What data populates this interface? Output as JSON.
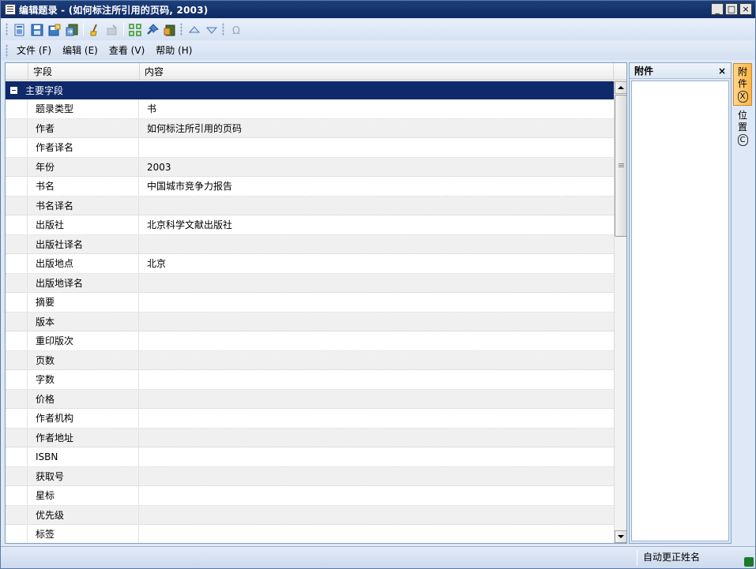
{
  "window": {
    "title": "编辑题录 - (如何标注所引用的页码, 2003)",
    "minimize": "_",
    "maximize": "□",
    "close": "×"
  },
  "toolbar": {
    "icons": [
      "new-record-icon",
      "save-icon",
      "save-as-icon",
      "export-icon",
      "clear-icon",
      "disabled-tool-icon",
      "grid-icon",
      "pin-icon",
      "attach-book-icon",
      "move-up-icon",
      "move-down-icon",
      "omega-icon"
    ]
  },
  "menu": {
    "file": "文件 (F)",
    "edit": "编辑 (E)",
    "view": "查看 (V)",
    "help": "帮助 (H)"
  },
  "grid": {
    "col_field": "字段",
    "col_value": "内容",
    "group_label": "主要字段",
    "rows": [
      {
        "field": "题录类型",
        "value": "书"
      },
      {
        "field": "作者",
        "value": "如何标注所引用的页码"
      },
      {
        "field": "作者译名",
        "value": ""
      },
      {
        "field": "年份",
        "value": "2003"
      },
      {
        "field": "书名",
        "value": "中国城市竞争力报告"
      },
      {
        "field": "书名译名",
        "value": ""
      },
      {
        "field": "出版社",
        "value": "北京科学文献出版社"
      },
      {
        "field": "出版社译名",
        "value": ""
      },
      {
        "field": "出版地点",
        "value": "北京"
      },
      {
        "field": "出版地译名",
        "value": ""
      },
      {
        "field": "摘要",
        "value": ""
      },
      {
        "field": "版本",
        "value": ""
      },
      {
        "field": "重印版次",
        "value": ""
      },
      {
        "field": "页数",
        "value": ""
      },
      {
        "field": "字数",
        "value": ""
      },
      {
        "field": "价格",
        "value": ""
      },
      {
        "field": "作者机构",
        "value": ""
      },
      {
        "field": "作者地址",
        "value": ""
      },
      {
        "field": "ISBN",
        "value": ""
      },
      {
        "field": "获取号",
        "value": ""
      },
      {
        "field": "星标",
        "value": ""
      },
      {
        "field": "优先级",
        "value": ""
      },
      {
        "field": "标签",
        "value": ""
      }
    ]
  },
  "attachments": {
    "title": "附件",
    "close": "×"
  },
  "side_tabs": {
    "attach_label_1": "附",
    "attach_label_2": "件",
    "attach_hotkey": "X",
    "location_label_1": "位",
    "location_label_2": "置",
    "location_hotkey": "C"
  },
  "status": {
    "text": "自动更正姓名"
  }
}
